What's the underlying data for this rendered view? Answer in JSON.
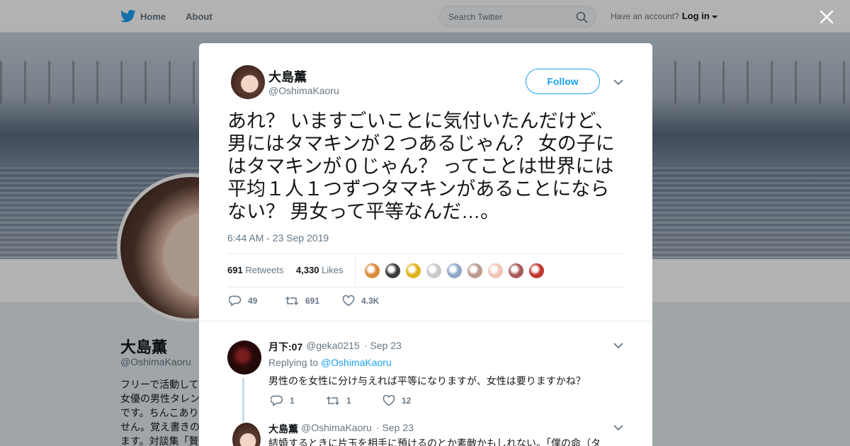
{
  "nav": {
    "home": "Home",
    "about": "About",
    "search_placeholder": "Search Twitter",
    "have_account": "Have an account?",
    "login": "Log in"
  },
  "profile": {
    "name": "大島薫",
    "handle": "@OshimaKaoru",
    "bio_lines": [
      "フリーで活動して",
      "女優の男性タレン",
      "です。ちんこあり",
      "せん。覚え書きの",
      "ます。対談集「贅"
    ]
  },
  "tweet": {
    "author_name": "大島薫",
    "author_handle": "@OshimaKaoru",
    "follow_label": "Follow",
    "text": "あれ？ いますごいことに気付いたんだけど、男にはタマキンが２つあるじゃん？ 女の子にはタマキンが０じゃん？ ってことは世界には平均１人１つずつタマキンがあることにならない？ 男女って平等なんだ…。",
    "timestamp": "6:44 AM - 23 Sep 2019",
    "retweets_count": "691",
    "retweets_label": "Retweets",
    "likes_count": "4,330",
    "likes_label": "Likes",
    "actions": {
      "replies": "49",
      "retweets": "691",
      "likes": "4.3K"
    }
  },
  "liker_avatars": [
    {
      "color": "#d98a3a"
    },
    {
      "color": "#3b3b3b"
    },
    {
      "color": "#e0b21a"
    },
    {
      "color": "#c9c9c9"
    },
    {
      "color": "#8fa6c7"
    },
    {
      "color": "#b99a8c"
    },
    {
      "color": "#f0c4b4"
    },
    {
      "color": "#a85a5a"
    },
    {
      "color": "#c0362c"
    }
  ],
  "replies": [
    {
      "name": "月下:07",
      "handle": "@geka0215",
      "date": "· Sep 23",
      "replying_to_label": "Replying to",
      "replying_to": "@OshimaKaoru",
      "text": "男性のを女性に分け与えれば平等になりますが、女性は要りますかね？",
      "replies": "1",
      "retweets": "1",
      "likes": "12"
    },
    {
      "name": "大島薫",
      "handle": "@OshimaKaoru",
      "date": "· Sep 23",
      "text": "結婚するときに片玉を相手に預けるのとか素敵かもしれない。「僕の命（タ"
    }
  ]
}
